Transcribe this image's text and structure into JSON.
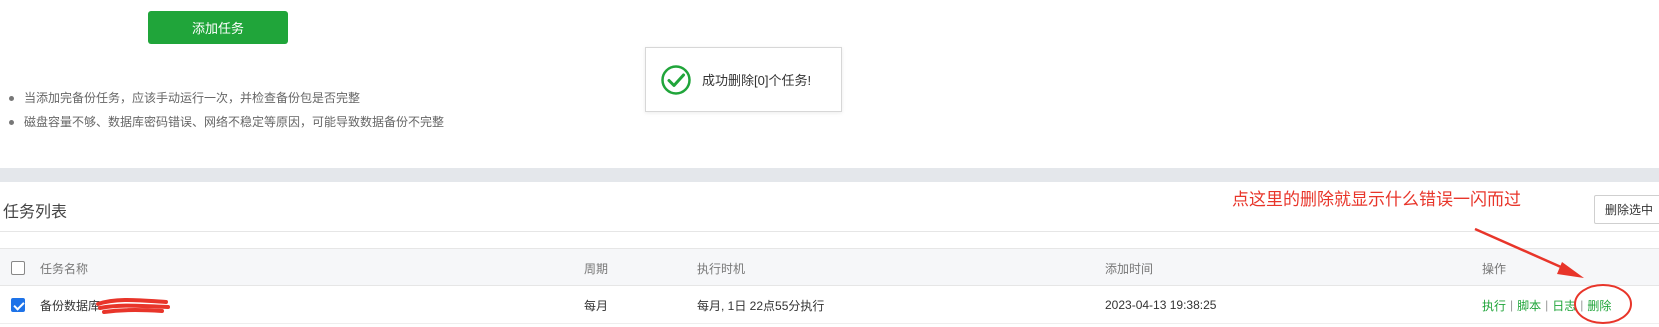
{
  "toolbar": {
    "add_task_label": "添加任务"
  },
  "tips": [
    "当添加完备份任务，应该手动运行一次，并检查备份包是否完整",
    "磁盘容量不够、数据库密码错误、网络不稳定等原因，可能导致数据备份不完整"
  ],
  "toast": {
    "message": "成功删除[0]个任务!",
    "icon": "check-circle-icon",
    "color": "#20a53a"
  },
  "panel": {
    "title": "任务列表",
    "delete_selected_label": "删除选中"
  },
  "annotation": {
    "text": "点这里的删除就显示什么错误一闪而过",
    "color": "#e8352a"
  },
  "table": {
    "headers": {
      "name": "任务名称",
      "cycle": "周期",
      "exec_time": "执行时机",
      "added_time": "添加时间",
      "actions": "操作"
    },
    "rows": [
      {
        "checked": true,
        "name": "备份数据库",
        "cycle": "每月",
        "exec_time": "每月, 1日 22点55分执行",
        "added_time": "2023-04-13 19:38:25",
        "actions": {
          "run": "执行",
          "script": "脚本",
          "log": "日志",
          "delete": "删除"
        }
      }
    ]
  },
  "colors": {
    "primary": "#20a53a",
    "checkbox": "#1e73e8",
    "band": "#e4e7eb"
  }
}
